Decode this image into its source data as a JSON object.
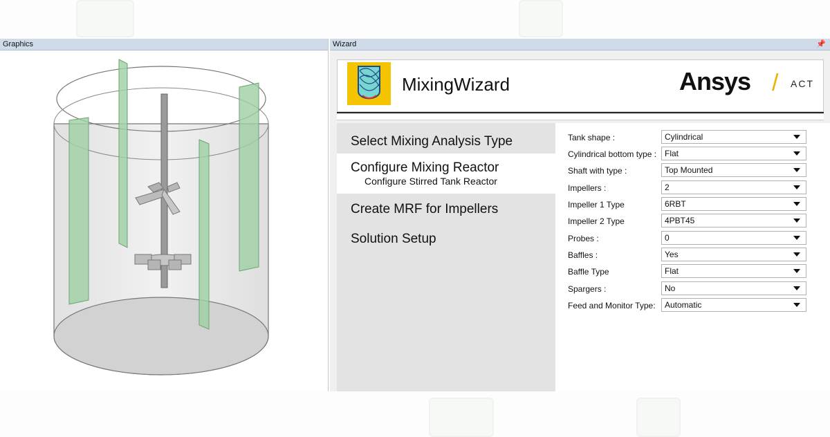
{
  "graphics": {
    "title": "Graphics"
  },
  "wizard": {
    "title": "Wizard",
    "app_name": "MixingWizard",
    "brand": "Ansys",
    "brand_suffix": "ACT",
    "steps": [
      {
        "label": "Select Mixing Analysis Type"
      },
      {
        "label": "Configure Mixing Reactor",
        "sub": "Configure Stirred Tank Reactor"
      },
      {
        "label": "Create MRF for Impellers"
      },
      {
        "label": "Solution Setup"
      }
    ],
    "fields": [
      {
        "label": "Tank shape :",
        "value": "Cylindrical"
      },
      {
        "label": "Cylindrical bottom type :",
        "value": "Flat"
      },
      {
        "label": "Shaft with type :",
        "value": "Top Mounted"
      },
      {
        "label": "Impellers :",
        "value": "2"
      },
      {
        "label": "Impeller 1 Type",
        "value": "6RBT"
      },
      {
        "label": "Impeller 2 Type",
        "value": "4PBT45"
      },
      {
        "label": "Probes :",
        "value": "0"
      },
      {
        "label": "Baffles :",
        "value": "Yes"
      },
      {
        "label": "Baffle Type",
        "value": "Flat"
      },
      {
        "label": "Spargers :",
        "value": "No"
      },
      {
        "label": "Feed and Monitor Type:",
        "value": "Automatic"
      }
    ]
  },
  "colors": {
    "accent": "#f5c400",
    "header_bar": "#cfdbe9",
    "baffle": "#9fd0a4"
  },
  "icons": {
    "pin": "pin-icon",
    "logo": "mixing-tank-logo-icon",
    "dropdown": "chevron-down-icon"
  }
}
